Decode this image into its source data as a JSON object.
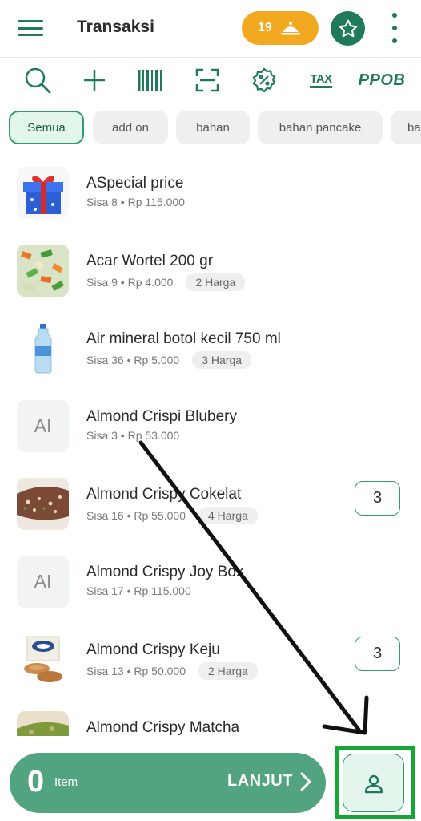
{
  "header": {
    "title": "Transaksi",
    "order_count": "19"
  },
  "toolbar": {
    "tools": [
      "search-icon",
      "plus-icon",
      "barcode-icon",
      "scan-icon",
      "discount-icon",
      "tax-icon",
      "ppob-icon"
    ],
    "tax_label": "TAX",
    "ppob_label": "PPOB"
  },
  "categories": [
    "Semua",
    "add on",
    "bahan",
    "bahan pancake",
    "ba"
  ],
  "products": [
    {
      "name": "ASpecial price",
      "stock": "Sisa 8",
      "price": "Rp 115.000",
      "badge": "",
      "qty": "",
      "thumb": "gift"
    },
    {
      "name": "Acar Wortel 200 gr",
      "stock": "Sisa 9",
      "price": "Rp 4.000",
      "badge": "2 Harga",
      "qty": "",
      "thumb": "veg"
    },
    {
      "name": "Air mineral botol kecil 750 ml",
      "stock": "Sisa 36",
      "price": "Rp 5.000",
      "badge": "3 Harga",
      "qty": "",
      "thumb": "bottle"
    },
    {
      "name": "Almond Crispi Blubery",
      "stock": "Sisa 3",
      "price": "Rp 53.000",
      "badge": "",
      "qty": "",
      "thumb": "AI"
    },
    {
      "name": "Almond Crispy Cokelat",
      "stock": "Sisa 16",
      "price": "Rp 55.000",
      "badge": "4 Harga",
      "qty": "3",
      "thumb": "choco"
    },
    {
      "name": "Almond Crispy Joy Box",
      "stock": "Sisa 17",
      "price": "Rp 115.000",
      "badge": "",
      "qty": "",
      "thumb": "AI"
    },
    {
      "name": "Almond Crispy Keju",
      "stock": "Sisa 13",
      "price": "Rp 50.000",
      "badge": "2 Harga",
      "qty": "3",
      "thumb": "keju"
    },
    {
      "name": "Almond Crispy Matcha",
      "stock": "",
      "price": "",
      "badge": "",
      "qty": "",
      "thumb": "matcha"
    }
  ],
  "bottom": {
    "count": "0",
    "item_label": "Item",
    "next_label": "LANJUT"
  },
  "colors": {
    "primary": "#1f7a5c",
    "accent": "#f3a91f",
    "bar": "#52a37f",
    "highlight": "#17a533"
  }
}
